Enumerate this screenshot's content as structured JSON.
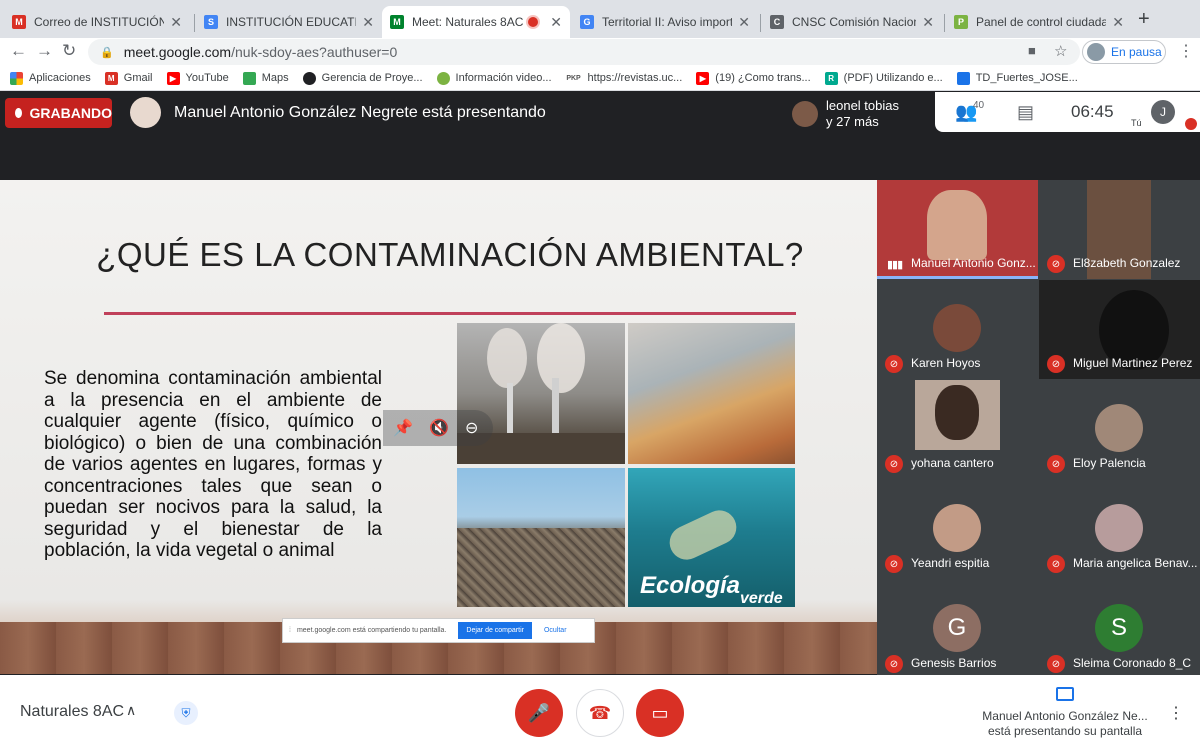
{
  "browser": {
    "tabs": [
      {
        "title": "Correo de INSTITUCIÓN EDUCATIVA",
        "favicon_text": "M",
        "favicon_color": "#d93025"
      },
      {
        "title": "INSTITUCIÓN EDUCATIVA LA",
        "favicon_text": "S",
        "favicon_color": "#4285f4"
      },
      {
        "title": "Meet: Naturales 8AC",
        "favicon_text": "M",
        "favicon_color": "#00832d"
      },
      {
        "title": "Territorial II: Aviso importante",
        "favicon_text": "G",
        "favicon_color": "#4285f4"
      },
      {
        "title": "CNSC Comisión Nacional del",
        "favicon_text": "C",
        "favicon_color": "#5f6368"
      },
      {
        "title": "Panel de control ciudadano",
        "favicon_text": "P",
        "favicon_color": "#7cb342"
      }
    ],
    "new_tab": "+",
    "url_host": "meet.google.com",
    "url_path": "/nuk-sdoy-aes?authuser=0",
    "profile_status": "En pausa",
    "bookmarks": [
      {
        "label": "Aplicaciones",
        "color": "#ea4335",
        "icon": ""
      },
      {
        "label": "Gmail",
        "color": "#d93025",
        "icon": "M"
      },
      {
        "label": "YouTube",
        "color": "#ff0000",
        "icon": "▶"
      },
      {
        "label": "Maps",
        "color": "#34a853",
        "icon": ""
      },
      {
        "label": "Gerencia de Proye...",
        "color": "#202124",
        "icon": ""
      },
      {
        "label": "Información video...",
        "color": "#7cb342",
        "icon": ""
      },
      {
        "label": "https://revistas.uc...",
        "color": "#555555",
        "icon": "PKP"
      },
      {
        "label": "(19) ¿Como trans...",
        "color": "#ff0000",
        "icon": "▶"
      },
      {
        "label": "(PDF) Utilizando e...",
        "color": "#00a98f",
        "icon": "R"
      },
      {
        "label": "TD_Fuertes_JOSE...",
        "color": "#1a73e8",
        "icon": ""
      }
    ]
  },
  "meet": {
    "recording_label": "GRABANDO",
    "presenting_label": "Manuel Antonio González Negrete está presentando",
    "joiners": {
      "line1": "leonel tobias",
      "line2": "y 27 más"
    },
    "participant_count": "40",
    "clock": "06:45",
    "self_initial": "J",
    "self_label": "Tú",
    "slide": {
      "title": "¿QUÉ ES LA CONTAMINACIÓN AMBIENTAL?",
      "body": "Se denomina contaminación ambiental a la presencia en el ambiente de cualquier agente (físico, químico o biológico) o bien de una combinación de varios agentes en lugares, formas y concentraciones tales que sean o puedan ser nocivos para la salud, la seguridad y el bienestar de la población, la vida vegetal o animal",
      "watermark_1": "Ecología",
      "watermark_2": "verde"
    },
    "share_notice": {
      "text": "meet.google.com está compartiendo tu pantalla.",
      "stop_label": "Dejar de compartir",
      "hide_label": "Ocultar"
    },
    "participants": [
      {
        "name": "Manuel Antonio Gonz...",
        "muted": false,
        "video": true,
        "color": "#b23a3a"
      },
      {
        "name": "El8zabeth Gonzalez",
        "muted": true,
        "video": true,
        "color": "#6b5040"
      },
      {
        "name": "Karen Hoyos",
        "muted": true,
        "video": false,
        "color": "#7a4a3a"
      },
      {
        "name": "Miguel Martinez Perez",
        "muted": true,
        "video": true,
        "color": "#222222"
      },
      {
        "name": "yohana cantero",
        "muted": true,
        "video": true,
        "color": "#b9a79a"
      },
      {
        "name": "Eloy Palencia",
        "muted": true,
        "video": false,
        "color": "#a08878"
      },
      {
        "name": "Yeandri espitia",
        "muted": true,
        "video": false,
        "color": "#c29b86"
      },
      {
        "name": "Maria angelica Benav...",
        "muted": true,
        "video": false,
        "color": "#b79c9c"
      },
      {
        "name": "Genesis Barrios",
        "muted": true,
        "video": false,
        "color": "#8d6e63",
        "initial": "G"
      },
      {
        "name": "Sleima Coronado 8_C",
        "muted": true,
        "video": false,
        "color": "#2e7d32",
        "initial": "S"
      }
    ],
    "meeting_name": "Naturales 8AC",
    "presenting_status_line1": "Manuel Antonio González Ne...",
    "presenting_status_line2": "está presentando su pantalla"
  }
}
